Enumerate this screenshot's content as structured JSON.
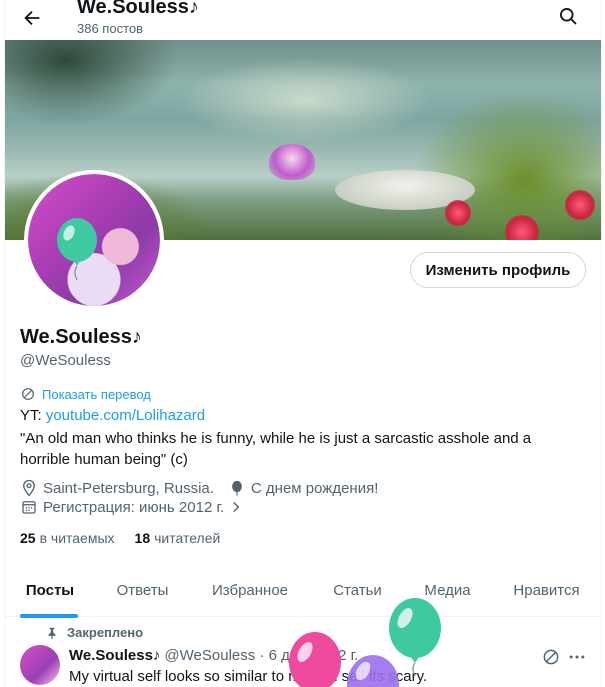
{
  "header": {
    "title": "We.Souless♪",
    "posts_count": "386 постов",
    "back_icon": "arrow-left-icon",
    "search_icon": "search-icon"
  },
  "profile": {
    "edit_button": "Изменить профиль",
    "name": "We.Souless♪",
    "handle": "@WeSouless",
    "show_translation": "Показать перевод",
    "bio_prefix": "YT: ",
    "bio_link": "youtube.com/Lolihazard",
    "bio_quote": "\"An old man who thinks he is funny, while he is just a sarcastic asshole and a horrible human being\" (c)",
    "location": "Saint-Petersburg, Russia.",
    "birthday": "С днем рождения!",
    "joined": "Регистрация: июнь 2012 г.",
    "following_count": "25",
    "following_label": "в читаемых",
    "followers_count": "18",
    "followers_label": "читателей"
  },
  "tabs": [
    {
      "label": "Посты",
      "active": true
    },
    {
      "label": "Ответы"
    },
    {
      "label": "Избранное"
    },
    {
      "label": "Статьи"
    },
    {
      "label": "Медиа"
    },
    {
      "label": "Нравится"
    }
  ],
  "pinned_post": {
    "pinned_label": "Закреплено",
    "author": "We.Souless♪",
    "meta": "@WeSouless · 6 дек. 2022 г.",
    "text": "My virtual self looks so similar to my real self its scary."
  },
  "colors": {
    "accent": "#1d9bf0",
    "text": "#0f1419",
    "muted": "#536471",
    "balloon_green": "#3ec9a0",
    "balloon_pink": "#f04a9e",
    "balloon_purple": "#9b6ff0"
  }
}
